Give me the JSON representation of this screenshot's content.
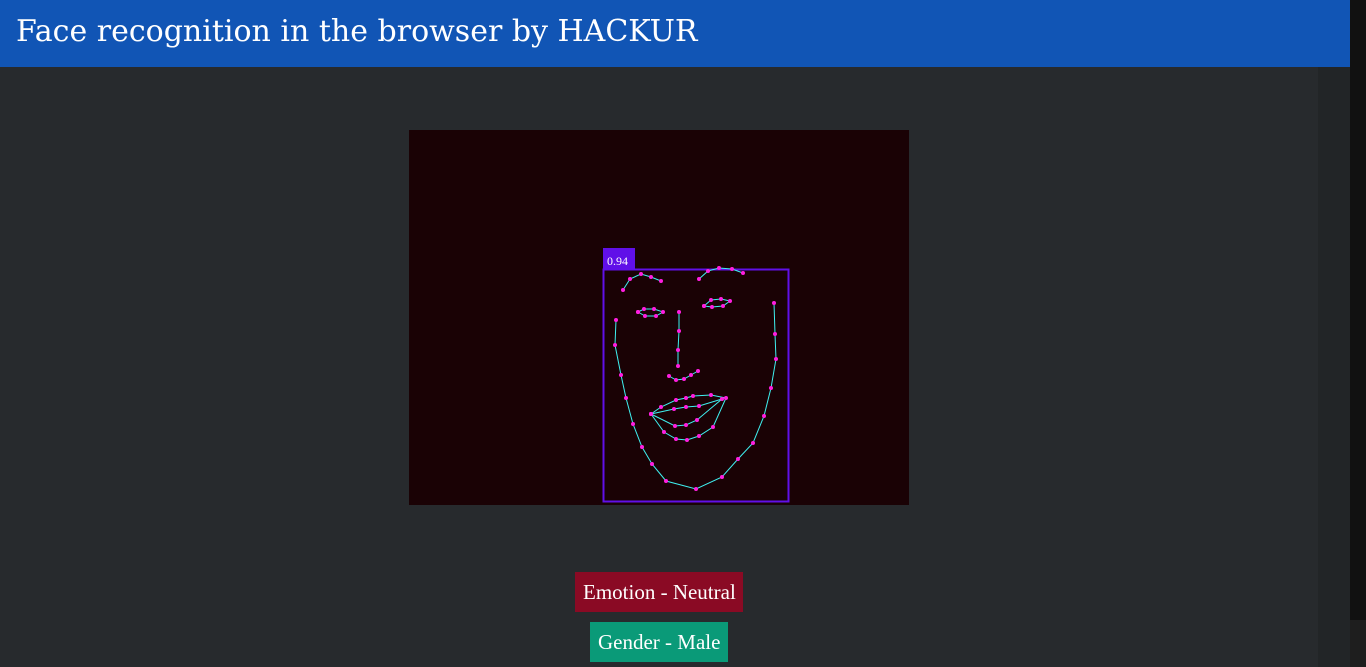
{
  "header": {
    "title": "Face recognition in the browser by HACKUR",
    "background_color": "#1155b5"
  },
  "detection": {
    "score_label": "0.94",
    "box_color": "#6010e8",
    "landmark_color": "#ff1ee0",
    "contour_color": "#3ff0f0"
  },
  "results": {
    "emotion_label": "Emotion - Neutral",
    "emotion_color": "#8a0a24",
    "gender_label": "Gender - Male",
    "gender_color": "#0a9a78"
  }
}
